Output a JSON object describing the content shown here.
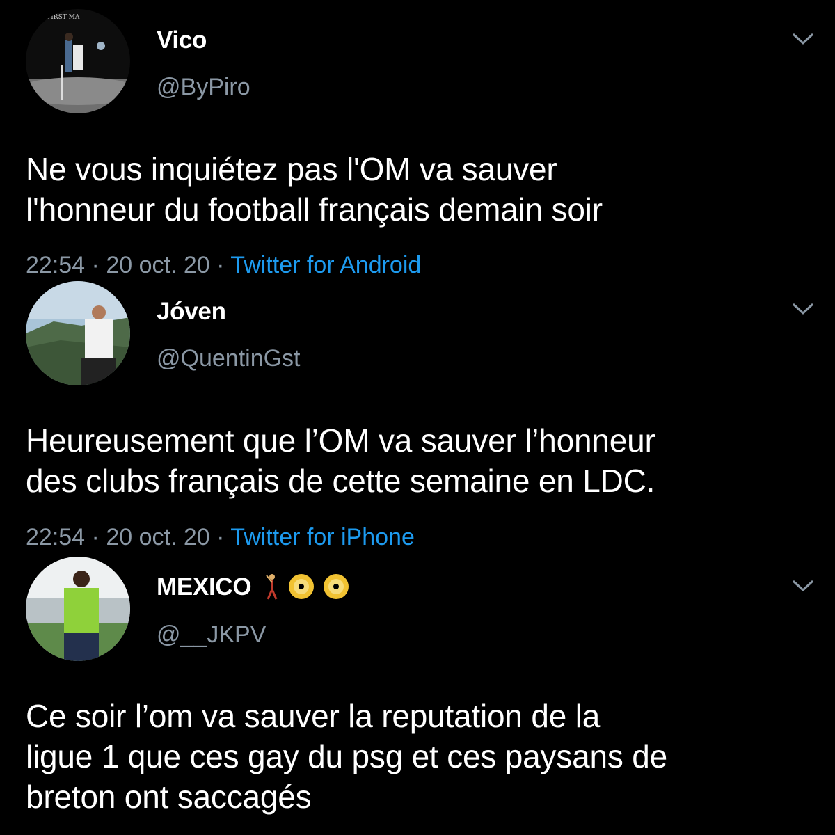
{
  "tweets": [
    {
      "display_name": "Vico",
      "handle": "@ByPiro",
      "text_lines": [
        "Ne vous inquiétez pas l'OM va sauver",
        "l'honneur du football français demain soir"
      ],
      "time": "22:54",
      "sep1": "·",
      "date": "20 oct. 20",
      "sep2": "·",
      "source": "Twitter for Android",
      "avatar_label": "FIRST MA"
    },
    {
      "display_name": "Jóven",
      "handle": "@QuentinGst",
      "text_lines": [
        "Heureusement que l’OM va sauver l’honneur",
        "des clubs français de cette semaine en LDC."
      ],
      "time": "22:54",
      "sep1": "·",
      "date": "20 oct. 20",
      "sep2": "·",
      "source": "Twitter for iPhone"
    },
    {
      "display_name": "MEXICO",
      "name_emojis": [
        "dancer-emoji",
        "dvd-emoji",
        "dvd-emoji"
      ],
      "handle": "@__JKPV",
      "text_lines": [
        "Ce soir l’om va sauver la reputation de la",
        "ligue 1 que ces gay du psg et ces paysans de",
        "breton ont saccagés"
      ]
    }
  ],
  "colors": {
    "background": "#000000",
    "text": "#ffffff",
    "secondary": "#8b98a5",
    "link": "#1d9bf0"
  }
}
